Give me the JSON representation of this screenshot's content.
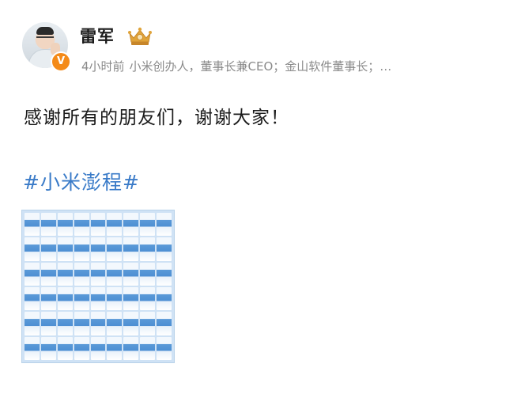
{
  "author": {
    "name": "雷军",
    "verified_badge_glyph": "V",
    "avatar_icon": "user-avatar",
    "crown_icon": "vip-crown-icon"
  },
  "meta": {
    "time": "4小时前",
    "bio": "小米创办人，董事长兼CEO；金山软件董事长；…"
  },
  "post": {
    "text": "感谢所有的朋友们，谢谢大家！",
    "hashtag": "#小米澎程#"
  },
  "image_grid": {
    "rows": 6,
    "cols": 9
  },
  "colors": {
    "link": "#3a7bc8",
    "meta_text": "#8a8a8a",
    "badge": "#f48a18"
  }
}
